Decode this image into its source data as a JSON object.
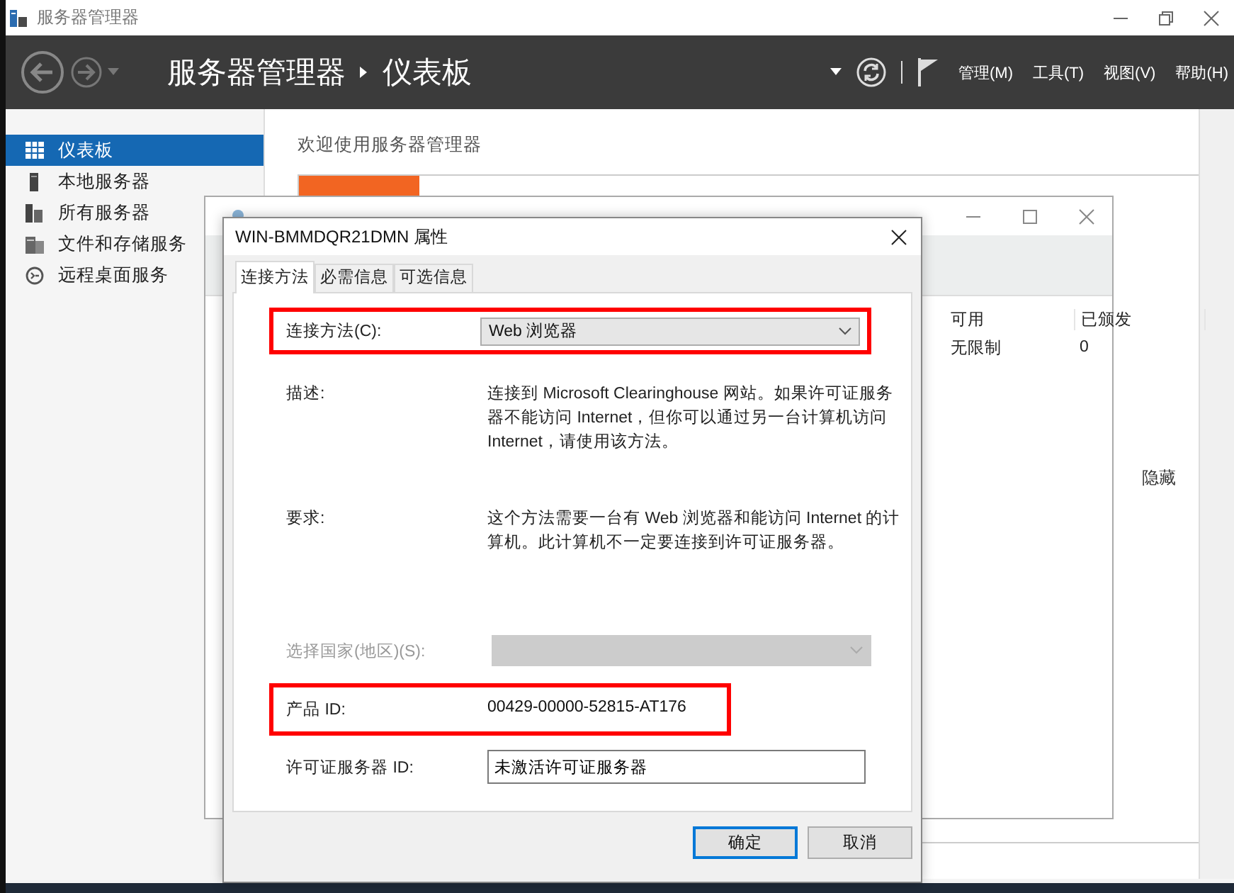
{
  "window": {
    "title": "服务器管理器"
  },
  "header": {
    "breadcrumb": [
      "服务器管理器",
      "仪表板"
    ],
    "menus": [
      "管理(M)",
      "工具(T)",
      "视图(V)",
      "帮助(H)"
    ]
  },
  "sidebar": {
    "items": [
      {
        "label": "仪表板",
        "kind": "dashboard",
        "selected": true
      },
      {
        "label": "本地服务器",
        "kind": "server",
        "selected": false
      },
      {
        "label": "所有服务器",
        "kind": "servers",
        "selected": false
      },
      {
        "label": "文件和存储服务",
        "kind": "storage",
        "selected": false
      },
      {
        "label": "远程桌面服务",
        "kind": "remote",
        "selected": false
      }
    ]
  },
  "main": {
    "heading": "欢迎使用服务器管理器",
    "hide_link": "隐藏"
  },
  "background_window": {
    "columns": [
      "可用",
      "已颁发"
    ],
    "rows": [
      [
        "无限制",
        "0"
      ]
    ]
  },
  "dialog": {
    "title": "WIN-BMMDQR21DMN 属性",
    "tabs": [
      {
        "label": "连接方法",
        "selected": true
      },
      {
        "label": "必需信息",
        "selected": false
      },
      {
        "label": "可选信息",
        "selected": false
      }
    ],
    "fields": [
      {
        "kind": "select",
        "label": "连接方法(C):",
        "value": "Web 浏览器",
        "highlighted": true,
        "disabled": false
      },
      {
        "kind": "text",
        "label": "描述:",
        "text": "连接到 Microsoft Clearinghouse 网站。如果许可证服务器不能访问 Internet，但你可以通过另一台计算机访问 Internet，请使用该方法。",
        "highlighted": false
      },
      {
        "kind": "text",
        "label": "要求:",
        "text": "这个方法需要一台有 Web 浏览器和能访问 Internet 的计算机。此计算机不一定要连接到许可证服务器。",
        "highlighted": false
      },
      {
        "kind": "select",
        "label": "选择国家(地区)(S):",
        "highlighted": false,
        "disabled": true
      },
      {
        "kind": "value",
        "label": "产品 ID:",
        "value": "00429-00000-52815-AT176",
        "highlighted": true
      },
      {
        "kind": "input",
        "label": "许可证服务器 ID:",
        "value": "未激活许可证服务器",
        "highlighted": false
      }
    ],
    "buttons": [
      {
        "label": "确定",
        "default": true
      },
      {
        "label": "取消",
        "default": false
      }
    ]
  }
}
